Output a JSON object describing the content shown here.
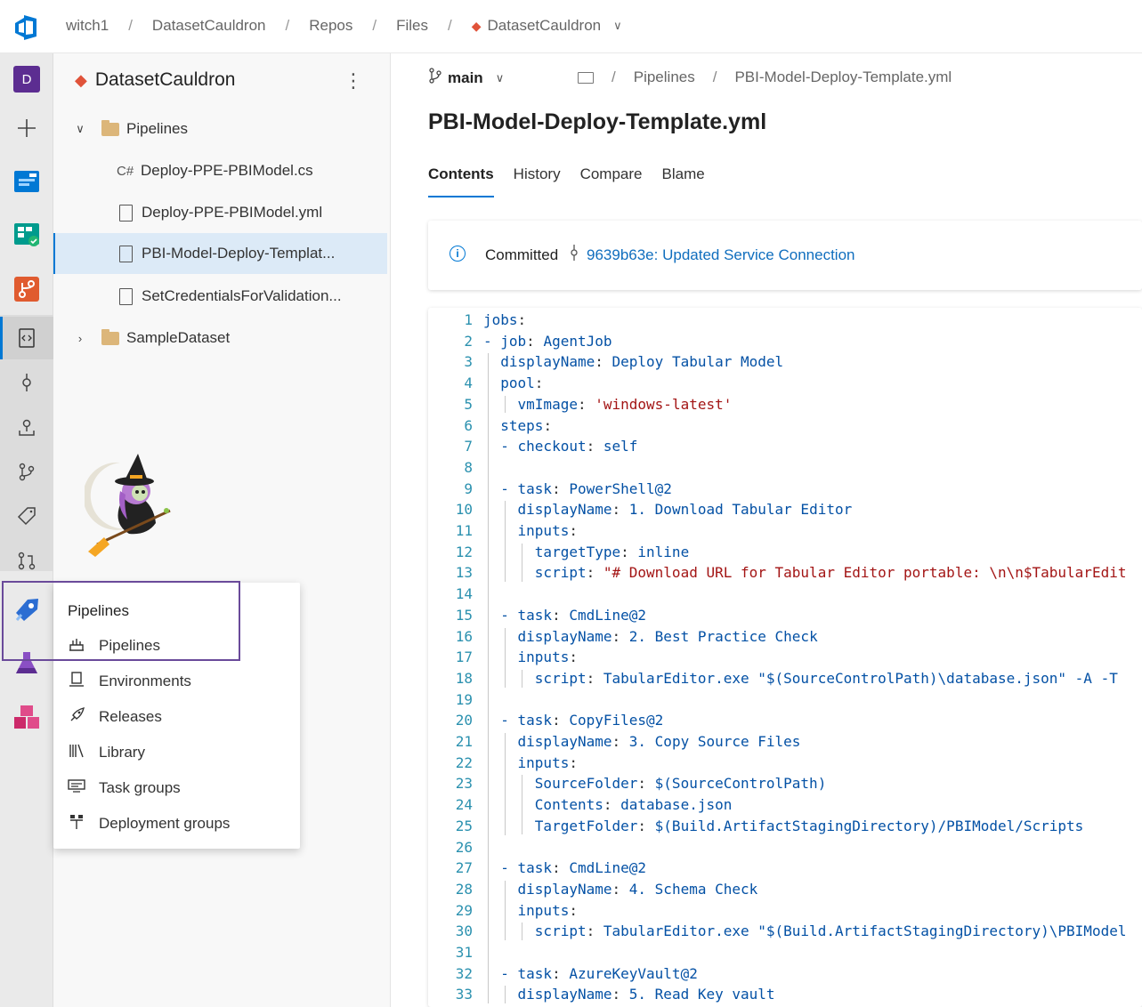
{
  "topbar": {
    "breadcrumbs": [
      "witch1",
      "DatasetCauldron",
      "Repos",
      "Files"
    ],
    "repo_name": "DatasetCauldron"
  },
  "rail": {
    "avatar_letter": "D",
    "items": [
      "plus-icon",
      "overview-icon",
      "boards-icon",
      "repos-icon",
      "files-icon",
      "commits-icon",
      "pushes-icon",
      "branches-icon",
      "tags-icon",
      "pull-requests-icon",
      "pipelines-icon",
      "test-plans-icon",
      "artifacts-icon"
    ]
  },
  "tree": {
    "repo_title": "DatasetCauldron",
    "nodes": [
      {
        "label": "Pipelines",
        "type": "folder",
        "expanded": true
      },
      {
        "label": "Deploy-PPE-PBIModel.cs",
        "type": "cs"
      },
      {
        "label": "Deploy-PPE-PBIModel.yml",
        "type": "file"
      },
      {
        "label": "PBI-Model-Deploy-Templat...",
        "type": "file",
        "selected": true
      },
      {
        "label": "SetCredentialsForValidation...",
        "type": "file"
      },
      {
        "label": "SampleDataset",
        "type": "folder",
        "expanded": false
      }
    ],
    "cs_prefix": "C#"
  },
  "flyout": {
    "title": "Pipelines",
    "items": [
      {
        "label": "Pipelines",
        "icon": "pipelines-icon"
      },
      {
        "label": "Environments",
        "icon": "environments-icon"
      },
      {
        "label": "Releases",
        "icon": "releases-icon"
      },
      {
        "label": "Library",
        "icon": "library-icon"
      },
      {
        "label": "Task groups",
        "icon": "task-groups-icon"
      },
      {
        "label": "Deployment groups",
        "icon": "deployment-groups-icon"
      }
    ]
  },
  "content": {
    "branch": "main",
    "path": [
      "Pipelines",
      "PBI-Model-Deploy-Template.yml"
    ],
    "file_title": "PBI-Model-Deploy-Template.yml",
    "tabs": [
      "Contents",
      "History",
      "Compare",
      "Blame"
    ],
    "active_tab": "Contents",
    "commit_label": "Committed",
    "commit_link": "9639b63e: Updated Service Connection"
  },
  "code_lines": [
    "jobs:",
    "- job: AgentJob",
    "  displayName: Deploy Tabular Model",
    "  pool:",
    "    vmImage: 'windows-latest'",
    "  steps:",
    "  - checkout: self",
    "",
    "  - task: PowerShell@2",
    "    displayName: 1. Download Tabular Editor",
    "    inputs:",
    "      targetType: inline",
    "      script: \"# Download URL for Tabular Editor portable: \\n\\n$TabularEdit",
    "",
    "  - task: CmdLine@2",
    "    displayName: 2. Best Practice Check",
    "    inputs:",
    "      script: TabularEditor.exe \"$(SourceControlPath)\\database.json\" -A -T",
    "",
    "  - task: CopyFiles@2",
    "    displayName: 3. Copy Source Files",
    "    inputs:",
    "      SourceFolder: $(SourceControlPath)",
    "      Contents: database.json",
    "      TargetFolder: $(Build.ArtifactStagingDirectory)/PBIModel/Scripts",
    "",
    "  - task: CmdLine@2",
    "    displayName: 4. Schema Check",
    "    inputs:",
    "      script: TabularEditor.exe \"$(Build.ArtifactStagingDirectory)\\PBIModel",
    "",
    "  - task: AzureKeyVault@2",
    "    displayName: 5. Read Key vault"
  ]
}
